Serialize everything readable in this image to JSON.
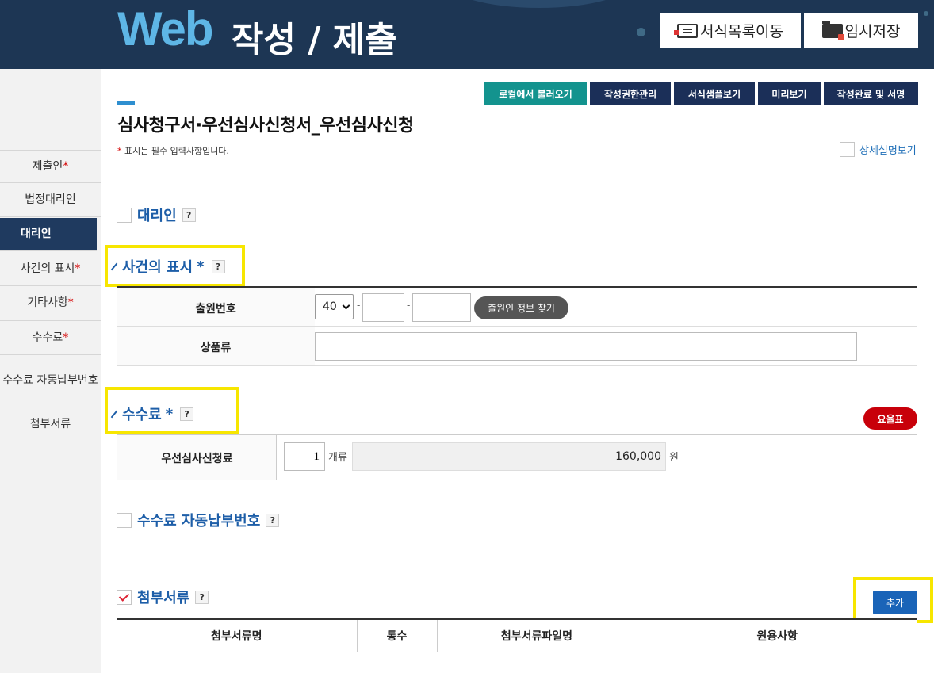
{
  "header": {
    "logo_web": "Web",
    "logo_rest": "작성 / 제출",
    "btn_form_list": "서식목록이동",
    "btn_temp_save": "임시저장"
  },
  "sidebar": {
    "items": [
      {
        "label": "제출인",
        "required": true
      },
      {
        "label": "법정대리인",
        "required": false
      },
      {
        "label": "대리인",
        "required": false,
        "active": true
      },
      {
        "label": "사건의 표시",
        "required": true
      },
      {
        "label": "기타사항",
        "required": true
      },
      {
        "label": "수수료",
        "required": true
      },
      {
        "label": "수수료 자동납부번호",
        "required": false
      },
      {
        "label": "첨부서류",
        "required": false
      }
    ]
  },
  "toolbar": {
    "load_local": "로컬에서 불러오기",
    "auth_manage": "작성권한관리",
    "sample_view": "서식샘플보기",
    "preview": "미리보기",
    "complete_sign": "작성완료 및 서명"
  },
  "page": {
    "title": "심사청구서·우선심사신청서_우선심사신청",
    "required_note_mark": "*",
    "required_note": " 표시는 필수 입력사항입니다.",
    "detail_toggle": "상세설명보기"
  },
  "sections": {
    "agent": {
      "title": "대리인",
      "checked": false
    },
    "case": {
      "title": "사건의 표시",
      "required_mark": "*",
      "app_no_label": "출원번호",
      "app_no_prefix": "40",
      "app_no_part2": "",
      "app_no_part3": "",
      "find_btn": "출원인 정보 찾기",
      "goods_label": "상품류",
      "goods_value": ""
    },
    "fee": {
      "title": "수수료",
      "required_mark": "*",
      "fee_table_btn": "요율표",
      "item_label": "우선심사신청료",
      "count": "1",
      "count_unit": "개류",
      "amount": "160,000",
      "currency": "원"
    },
    "autopay": {
      "title": "수수료 자동납부번호",
      "checked": false
    },
    "attachments": {
      "title": "첨부서류",
      "checked": true,
      "add_btn": "추가",
      "columns": [
        "첨부서류명",
        "통수",
        "첨부서류파일명",
        "원용사항"
      ]
    }
  },
  "help_label": "?",
  "colors": {
    "header_bg": "#1d3654",
    "logo_accent": "#5eb6e6",
    "section_title": "#1d5ea8",
    "highlight": "#f7e600",
    "teal_btn": "#13938e",
    "navy_btn": "#1b2f58",
    "red_btn": "#c8000a",
    "blue_btn": "#1a64b8"
  }
}
